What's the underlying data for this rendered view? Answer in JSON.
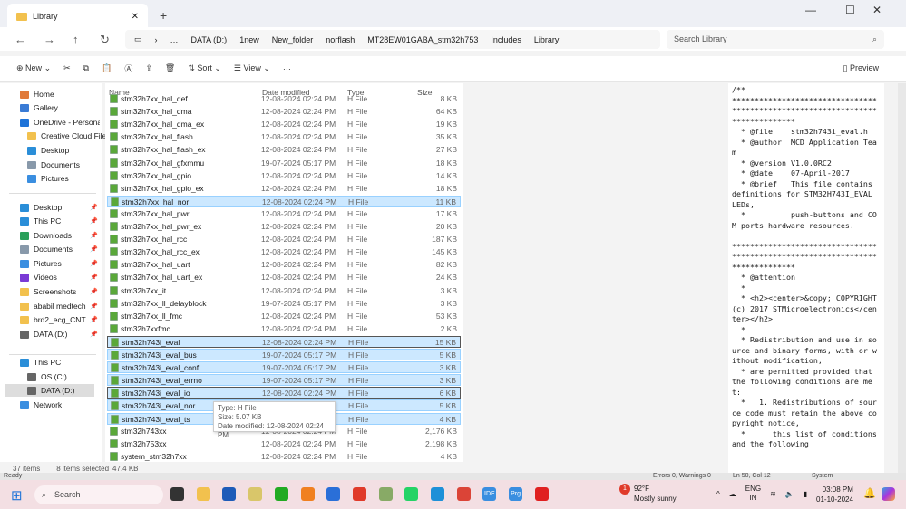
{
  "window": {
    "tab_title": "Library",
    "new_tab": "+",
    "min": "—",
    "max": "☐",
    "close": "✕"
  },
  "address": {
    "crumbs": [
      "DATA (D:)",
      "1new",
      "New_folder",
      "norflash",
      "MT28EW01GABA_stm32h753",
      "Includes",
      "Library"
    ],
    "more": "…",
    "search_placeholder": "Search Library"
  },
  "toolbar": {
    "new": "New",
    "sort": "Sort",
    "view": "View",
    "more": "···",
    "preview": "Preview"
  },
  "sidebar": [
    {
      "label": "Home",
      "color": "#e07a3a",
      "pin": false
    },
    {
      "label": "Gallery",
      "color": "#3a7bd5",
      "pin": false
    },
    {
      "label": "OneDrive - Personal",
      "color": "#1e73d8",
      "pin": false
    },
    {
      "label": "Creative Cloud Files",
      "color": "#f2c14e",
      "pin": false,
      "indent": true
    },
    {
      "label": "Desktop",
      "color": "#2a8ed8",
      "pin": false,
      "indent": true
    },
    {
      "label": "Documents",
      "color": "#8899aa",
      "pin": false,
      "indent": true
    },
    {
      "label": "Pictures",
      "color": "#3a8ee0",
      "pin": false,
      "indent": true
    },
    {
      "label": "Desktop",
      "color": "#2a8ed8",
      "pin": true
    },
    {
      "label": "This PC",
      "color": "#2a8ed8",
      "pin": true
    },
    {
      "label": "Downloads",
      "color": "#2aa05a",
      "pin": true
    },
    {
      "label": "Documents",
      "color": "#8899aa",
      "pin": true
    },
    {
      "label": "Pictures",
      "color": "#3a8ee0",
      "pin": true
    },
    {
      "label": "Videos",
      "color": "#7a3ad5",
      "pin": true
    },
    {
      "label": "Screenshots",
      "color": "#f2c14e",
      "pin": true
    },
    {
      "label": "ababil medtech",
      "color": "#f2c14e",
      "pin": true
    },
    {
      "label": "brd2_ecg_CNT",
      "color": "#f2c14e",
      "pin": true
    },
    {
      "label": "DATA (D:)",
      "color": "#666",
      "pin": true
    },
    {
      "label": "This PC",
      "color": "#2a8ed8",
      "pin": false
    },
    {
      "label": "OS (C:)",
      "color": "#666",
      "pin": false,
      "indent": true
    },
    {
      "label": "DATA (D:)",
      "color": "#666",
      "pin": false,
      "indent": true,
      "selected": true
    },
    {
      "label": "Network",
      "color": "#3a8ee0",
      "pin": false
    }
  ],
  "columns": {
    "name": "Name",
    "date": "Date modified",
    "type": "Type",
    "size": "Size"
  },
  "files": [
    [
      "stm32h7xx_hal_def",
      "12-08-2024 02:24 PM",
      "H File",
      "8 KB",
      0
    ],
    [
      "stm32h7xx_hal_dma",
      "12-08-2024 02:24 PM",
      "H File",
      "64 KB",
      0
    ],
    [
      "stm32h7xx_hal_dma_ex",
      "12-08-2024 02:24 PM",
      "H File",
      "19 KB",
      0
    ],
    [
      "stm32h7xx_hal_flash",
      "12-08-2024 02:24 PM",
      "H File",
      "35 KB",
      0
    ],
    [
      "stm32h7xx_hal_flash_ex",
      "12-08-2024 02:24 PM",
      "H File",
      "27 KB",
      0
    ],
    [
      "stm32h7xx_hal_gfxmmu",
      "19-07-2024 05:17 PM",
      "H File",
      "18 KB",
      0
    ],
    [
      "stm32h7xx_hal_gpio",
      "12-08-2024 02:24 PM",
      "H File",
      "14 KB",
      0
    ],
    [
      "stm32h7xx_hal_gpio_ex",
      "12-08-2024 02:24 PM",
      "H File",
      "18 KB",
      0
    ],
    [
      "stm32h7xx_hal_nor",
      "12-08-2024 02:24 PM",
      "H File",
      "11 KB",
      1
    ],
    [
      "stm32h7xx_hal_pwr",
      "12-08-2024 02:24 PM",
      "H File",
      "17 KB",
      0
    ],
    [
      "stm32h7xx_hal_pwr_ex",
      "12-08-2024 02:24 PM",
      "H File",
      "20 KB",
      0
    ],
    [
      "stm32h7xx_hal_rcc",
      "12-08-2024 02:24 PM",
      "H File",
      "187 KB",
      0
    ],
    [
      "stm32h7xx_hal_rcc_ex",
      "12-08-2024 02:24 PM",
      "H File",
      "145 KB",
      0
    ],
    [
      "stm32h7xx_hal_uart",
      "12-08-2024 02:24 PM",
      "H File",
      "82 KB",
      0
    ],
    [
      "stm32h7xx_hal_uart_ex",
      "12-08-2024 02:24 PM",
      "H File",
      "24 KB",
      0
    ],
    [
      "stm32h7xx_it",
      "12-08-2024 02:24 PM",
      "H File",
      "3 KB",
      0
    ],
    [
      "stm32h7xx_ll_delayblock",
      "19-07-2024 05:17 PM",
      "H File",
      "3 KB",
      0
    ],
    [
      "stm32h7xx_ll_fmc",
      "12-08-2024 02:24 PM",
      "H File",
      "53 KB",
      0
    ],
    [
      "stm32h7xxfmc",
      "12-08-2024 02:24 PM",
      "H File",
      "2 KB",
      0
    ],
    [
      "stm32h743i_eval",
      "12-08-2024 02:24 PM",
      "H File",
      "15 KB",
      2
    ],
    [
      "stm32h743i_eval_bus",
      "19-07-2024 05:17 PM",
      "H File",
      "5 KB",
      1
    ],
    [
      "stm32h743i_eval_conf",
      "19-07-2024 05:17 PM",
      "H File",
      "3 KB",
      1
    ],
    [
      "stm32h743i_eval_errno",
      "19-07-2024 05:17 PM",
      "H File",
      "3 KB",
      1
    ],
    [
      "stm32h743i_eval_io",
      "12-08-2024 02:24 PM",
      "H File",
      "6 KB",
      2
    ],
    [
      "stm32h743i_eval_nor",
      "12-08-2024 02:24 PM",
      "H File",
      "5 KB",
      1
    ],
    [
      "stm32h743i_eval_ts",
      "12-08-2024 02:24 PM",
      "H File",
      "4 KB",
      1
    ],
    [
      "stm32h743xx",
      "12-08-2024 02:24 PM",
      "H File",
      "2,176 KB",
      0
    ],
    [
      "stm32h753xx",
      "12-08-2024 02:24 PM",
      "H File",
      "2,198 KB",
      0
    ],
    [
      "system_stm32h7xx",
      "12-08-2024 02:24 PM",
      "H File",
      "4 KB",
      0
    ]
  ],
  "tooltip": {
    "type": "Type: H File",
    "size": "Size: 5.07 KB",
    "date": "Date modified: 12-08-2024 02:24 PM"
  },
  "preview_text": "/**\n******************************************************************************\n  * @file    stm32h743i_eval.h\n  * @author  MCD Application Team\n  * @version V1.0.0RC2\n  * @date    07-April-2017\n  * @brief   This file contains definitions for STM32H743I_EVAL LEDs,\n  *          push-buttons and COM ports hardware resources.\n\n******************************************************************************\n  * @attention\n  *\n  * <h2><center>&copy; COPYRIGHT(c) 2017 STMicroelectronics</center></h2>\n  *\n  * Redistribution and use in source and binary forms, with or without modification,\n  * are permitted provided that the following conditions are met:\n  *   1. Redistributions of source code must retain the above copyright notice,\n  *      this list of conditions and the following",
  "status": {
    "items": "37 items",
    "selected": "8 items selected",
    "size": "47.4 KB"
  },
  "bg_status": {
    "ready": "Ready",
    "errors": "Errors 0, Warnings 0",
    "pos": "Ln 50, Col 12",
    "enc": "System"
  },
  "taskbar": {
    "search": "Search",
    "weather_temp": "92°F",
    "weather_desc": "Mostly sunny",
    "badge": "1",
    "lang1": "ENG",
    "lang2": "IN",
    "time": "03:08 PM",
    "date": "01-10-2024",
    "apps": [
      {
        "color": "#333"
      },
      {
        "color": "#f2c14e"
      },
      {
        "color": "#1e5bb8"
      },
      {
        "color": "#d9c66a"
      },
      {
        "color": "#2a2"
      },
      {
        "color": "#f08020"
      },
      {
        "color": "#2a6fd8"
      },
      {
        "color": "#e03a2a"
      },
      {
        "color": "#8a6"
      },
      {
        "color": "#25d366"
      },
      {
        "color": "#1e90d8"
      },
      {
        "color": "#db4437"
      },
      {
        "color": "#3a8ee0",
        "text": "IDE"
      },
      {
        "color": "#3a8ee0",
        "text": "Prg"
      },
      {
        "color": "#e02020"
      }
    ]
  }
}
